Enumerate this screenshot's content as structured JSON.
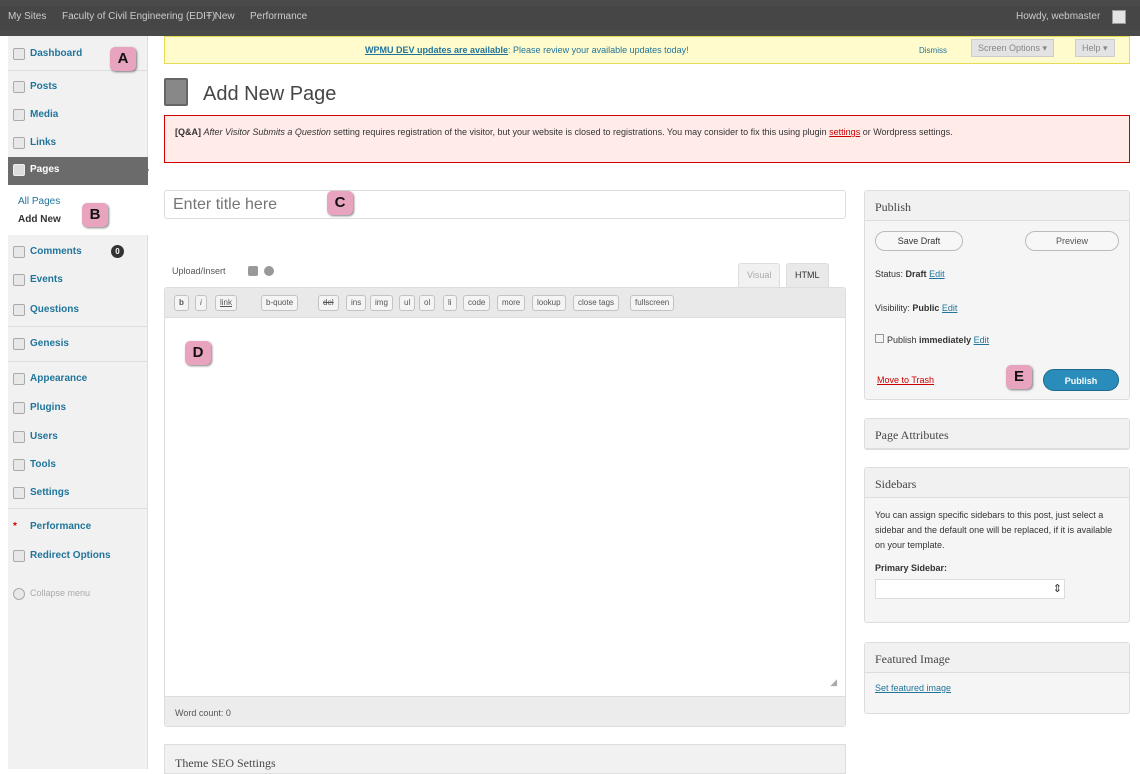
{
  "admin_bar": {
    "my_sites": "My Sites",
    "site_name": "Faculty of Civil Engineering (EDIT)",
    "new": "+ New",
    "performance": "Performance",
    "howdy": "Howdy, webmaster"
  },
  "sidebar": {
    "items": [
      {
        "label": "Dashboard",
        "icon": "dashboard-icon"
      },
      {
        "label": "Posts",
        "icon": "posts-icon"
      },
      {
        "label": "Media",
        "icon": "media-icon"
      },
      {
        "label": "Links",
        "icon": "links-icon"
      },
      {
        "label": "Pages",
        "icon": "pages-icon"
      },
      {
        "label": "Comments",
        "icon": "comments-icon",
        "count": "0"
      },
      {
        "label": "Events",
        "icon": "events-icon"
      },
      {
        "label": "Questions",
        "icon": "questions-icon"
      },
      {
        "label": "Genesis",
        "icon": "genesis-icon"
      },
      {
        "label": "Appearance",
        "icon": "appearance-icon"
      },
      {
        "label": "Plugins",
        "icon": "plugins-icon"
      },
      {
        "label": "Users",
        "icon": "users-icon"
      },
      {
        "label": "Tools",
        "icon": "tools-icon"
      },
      {
        "label": "Settings",
        "icon": "settings-icon"
      },
      {
        "label": "Performance",
        "icon": "performance-icon"
      },
      {
        "label": "Redirect Options",
        "icon": "redirect-icon"
      }
    ],
    "submenu": {
      "all_pages": "All Pages",
      "add_new": "Add New"
    },
    "collapse": "Collapse menu"
  },
  "notices": {
    "updates_link": "WPMU DEV updates are available",
    "updates_text": ": Please review your available updates today!",
    "dismiss": "Dismiss",
    "screen_options": "Screen Options ▾",
    "help": "Help ▾",
    "qa_label": "[Q&A]",
    "qa_italic": "After Visitor Submits a Question",
    "qa_text": " setting requires registration of the visitor, but your website is closed to registrations. You may consider to fix this using plugin ",
    "qa_link": "settings",
    "qa_tail": " or Wordpress settings."
  },
  "page": {
    "title": "Add New Page"
  },
  "editor": {
    "title_placeholder": "Enter title here",
    "upload_insert": "Upload/Insert",
    "tab_visual": "Visual",
    "tab_html": "HTML",
    "quicktags": [
      "b",
      "i",
      "link",
      "b-quote",
      "del",
      "ins",
      "img",
      "ul",
      "ol",
      "li",
      "code",
      "more",
      "lookup",
      "close tags",
      "fullscreen"
    ],
    "word_count": "Word count: 0"
  },
  "publish_box": {
    "title": "Publish",
    "save_draft": "Save Draft",
    "preview": "Preview",
    "status_label": "Status:",
    "status_value": "Draft",
    "visibility_label": "Visibility:",
    "visibility_value": "Public",
    "publish_label": "Publish",
    "publish_value": "immediately",
    "edit": "Edit",
    "move_to_trash": "Move to Trash",
    "publish_button": "Publish"
  },
  "page_attributes": {
    "title": "Page Attributes"
  },
  "sidebars_box": {
    "title": "Sidebars",
    "description": "You can assign specific sidebars to this post, just select a sidebar and the default one will be replaced, if it is available on your template.",
    "primary_label": "Primary Sidebar:"
  },
  "featured_image": {
    "title": "Featured Image",
    "link": "Set featured image"
  },
  "seo": {
    "title": "Theme SEO Settings"
  },
  "callouts": [
    "A",
    "B",
    "C",
    "D",
    "E"
  ],
  "colors": {
    "admin_bar": "#464646",
    "link": "#21759b",
    "publish": "#298cba",
    "callout": "#e8a3bf",
    "error": "#cc0000"
  }
}
